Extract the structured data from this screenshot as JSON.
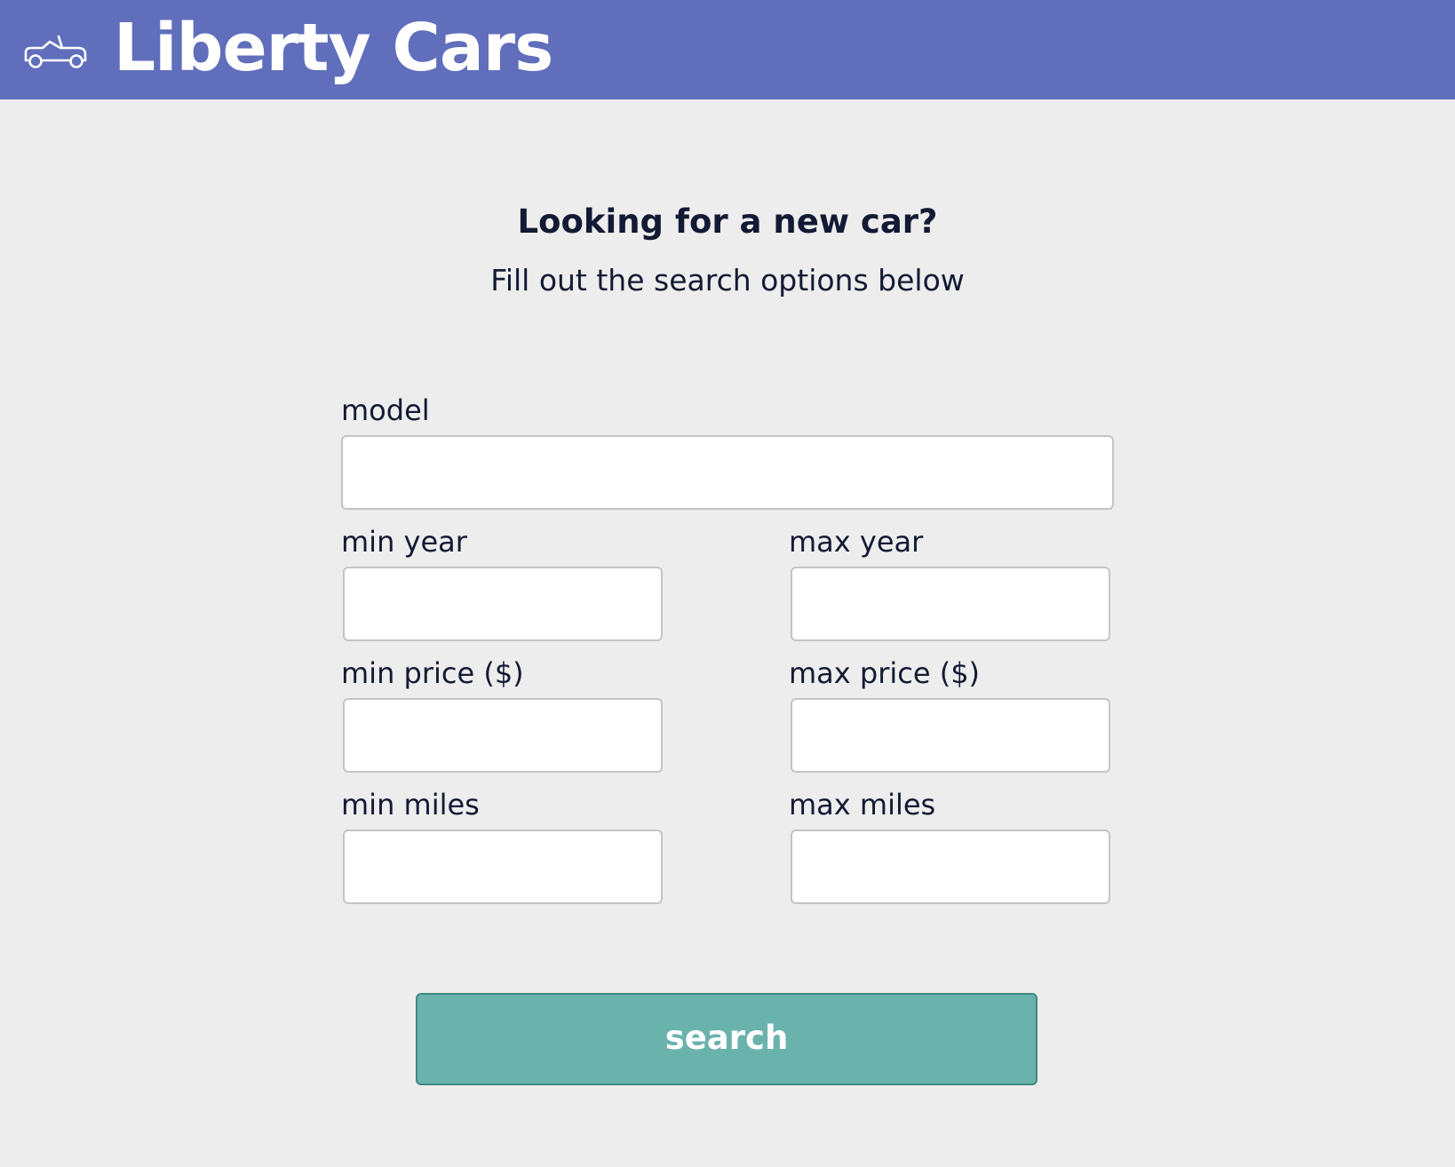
{
  "header": {
    "logo_icon": "convertible-car-icon",
    "brand": "Liberty Cars",
    "color": "#606ebc"
  },
  "hero": {
    "title": "Looking for a new car?",
    "subtitle": "Fill out the search options below"
  },
  "form": {
    "model": {
      "label": "model",
      "value": ""
    },
    "min_year": {
      "label": "min year",
      "value": ""
    },
    "max_year": {
      "label": "max year",
      "value": ""
    },
    "min_price": {
      "label": "min price ($)",
      "value": ""
    },
    "max_price": {
      "label": "max price ($)",
      "value": ""
    },
    "min_miles": {
      "label": "min miles",
      "value": ""
    },
    "max_miles": {
      "label": "max miles",
      "value": ""
    }
  },
  "search_button": {
    "label": "search",
    "color": "#6ab3ad"
  }
}
